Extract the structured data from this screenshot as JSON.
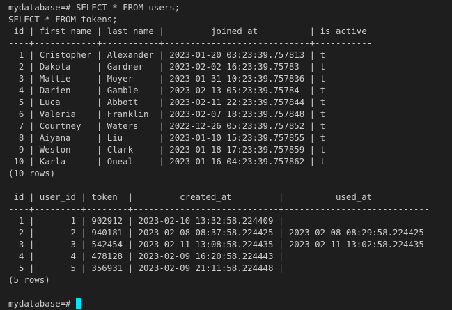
{
  "terminal": {
    "cursor_color": "#00e5ff",
    "background": "#1e1e1e",
    "foreground": "#cccccc",
    "lines": [
      "mydatabase=# SELECT * FROM users;",
      "SELECT * FROM tokens;",
      " id | first_name | last_name |         joined_at          | is_active",
      "----+------------+-----------+----------------------------+-----------",
      "  1 | Cristopher | Alexander | 2023-01-20 03:23:39.757813 | t",
      "  2 | Dakota     | Gardner   | 2023-02-02 16:23:39.75783  | t",
      "  3 | Mattie     | Moyer     | 2023-01-31 10:23:39.757836 | t",
      "  4 | Darien     | Gamble    | 2023-02-13 05:23:39.75784  | t",
      "  5 | Luca       | Abbott    | 2023-02-11 22:23:39.757844 | t",
      "  6 | Valeria    | Franklin  | 2023-02-07 18:23:39.757848 | t",
      "  7 | Courtney   | Waters    | 2022-12-26 05:23:39.757852 | t",
      "  8 | Aiyana     | Liu       | 2023-01-10 15:23:39.757855 | t",
      "  9 | Weston     | Clark     | 2023-01-18 17:23:39.757859 | t",
      " 10 | Karla      | Oneal     | 2023-01-16 04:23:39.757862 | t",
      "(10 rows)",
      "",
      " id | user_id | token  |         created_at         |          used_at",
      "----+---------+--------+----------------------------+----------------------------",
      "  1 |       1 | 902912 | 2023-02-10 13:32:58.224409 |",
      "  2 |       2 | 940181 | 2023-02-08 08:37:58.224425 | 2023-02-08 08:29:58.224425",
      "  3 |       3 | 542454 | 2023-02-11 13:08:58.224435 | 2023-02-11 13:02:58.224435",
      "  4 |       4 | 478128 | 2023-02-09 16:20:58.224443 |",
      "  5 |       5 | 356931 | 2023-02-09 21:11:58.224448 |",
      "(5 rows)",
      "",
      "mydatabase=# "
    ]
  }
}
